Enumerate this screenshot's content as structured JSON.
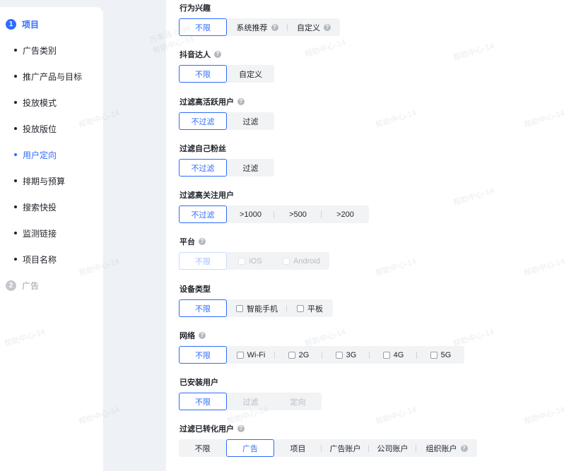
{
  "nav": {
    "step1": {
      "num": "1",
      "label": "项目"
    },
    "items": [
      {
        "label": "广告类别"
      },
      {
        "label": "推广产品与目标"
      },
      {
        "label": "投放模式"
      },
      {
        "label": "投放版位"
      },
      {
        "label": "用户定向",
        "active": true
      },
      {
        "label": "排期与预算"
      },
      {
        "label": "搜索快投"
      },
      {
        "label": "监测链接"
      },
      {
        "label": "项目名称"
      }
    ],
    "step2": {
      "num": "2",
      "label": "广告"
    }
  },
  "form": {
    "interest": {
      "title": "行为兴趣",
      "options": [
        "不限",
        "系统推荐",
        "自定义"
      ]
    },
    "douyin": {
      "title": "抖音达人",
      "options": [
        "不限",
        "自定义"
      ]
    },
    "active_users": {
      "title": "过滤高活跃用户",
      "options": [
        "不过滤",
        "过滤"
      ]
    },
    "own_fans": {
      "title": "过滤自己粉丝",
      "options": [
        "不过滤",
        "过滤"
      ]
    },
    "high_follow": {
      "title": "过滤高关注用户",
      "options": [
        "不过滤",
        ">1000",
        ">500",
        ">200"
      ]
    },
    "platform": {
      "title": "平台",
      "options": [
        "不限",
        "iOS",
        "Android"
      ]
    },
    "device": {
      "title": "设备类型",
      "options": [
        "不限",
        "智能手机",
        "平板"
      ]
    },
    "network": {
      "title": "网络",
      "options": [
        "不限",
        "Wi-Fi",
        "2G",
        "3G",
        "4G",
        "5G"
      ]
    },
    "installed": {
      "title": "已安装用户",
      "options": [
        "不限",
        "过滤",
        "定向"
      ]
    },
    "converted": {
      "title": "过滤已转化用户",
      "options": [
        "不限",
        "广告",
        "项目",
        "广告账户",
        "公司账户",
        "组织账户"
      ]
    }
  },
  "icons": {
    "help": "question-circle-icon",
    "checkbox": "checkbox-icon"
  },
  "watermark": {
    "a": "帮助中心-14",
    "b": "万事通 0396"
  },
  "colors": {
    "accent": "#2f6bff",
    "background": "#eef1f5"
  }
}
